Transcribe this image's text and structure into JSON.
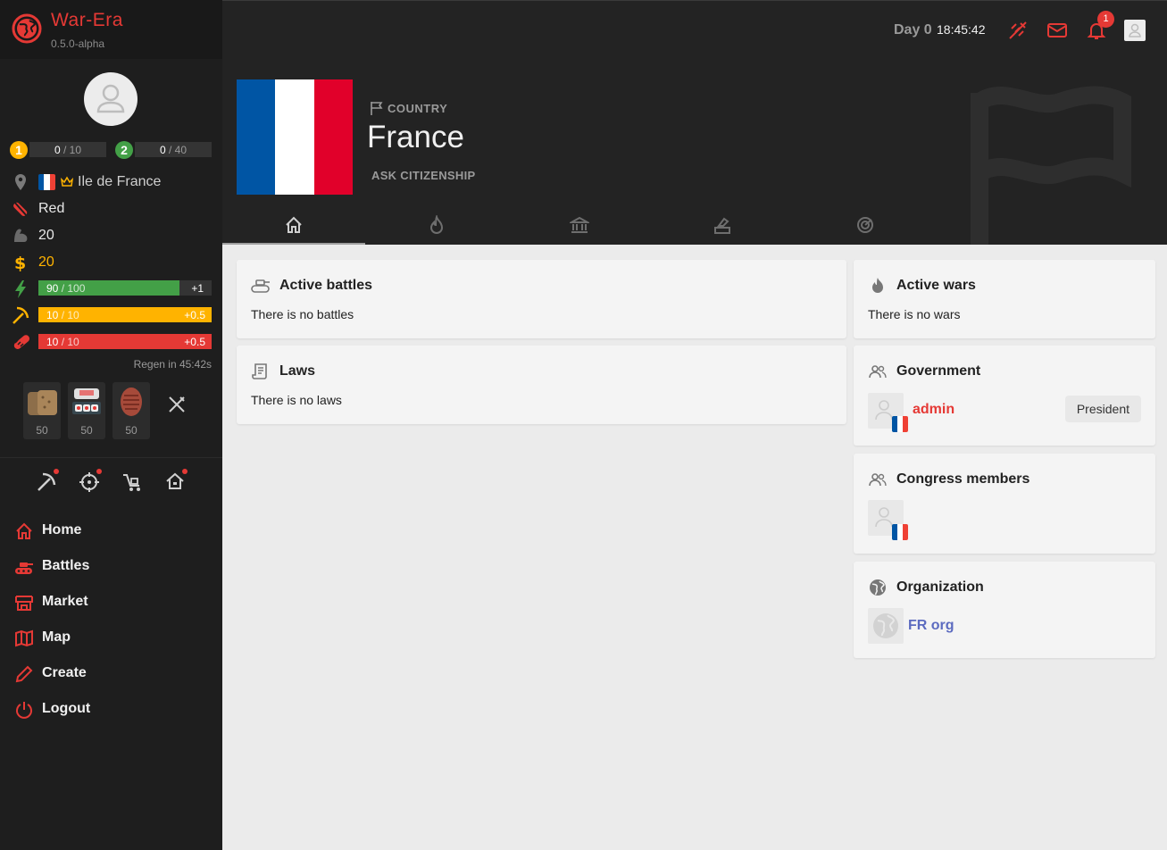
{
  "app": {
    "name": "War-Era",
    "version": "0.5.0-alpha"
  },
  "colors": {
    "brand": "#e53935",
    "energy": "#43a047",
    "work": "#ffb300",
    "health": "#e53935",
    "level1": "#ffb300",
    "level2": "#43a047",
    "link": "#5c6bc0"
  },
  "player": {
    "level1": {
      "badge": "1",
      "current": "0",
      "max": "/ 10",
      "progress": 0
    },
    "level2": {
      "badge": "2",
      "current": "0",
      "max": "/ 40",
      "progress": 0
    },
    "region": "Ile de France",
    "party": "Red",
    "strength": "20",
    "money": "20",
    "energy": {
      "current": "90",
      "max": "/ 100",
      "rate": "+1",
      "progress": 0.9
    },
    "work": {
      "current": "10",
      "max": "/ 10",
      "rate": "+0.5",
      "progress": 1.0
    },
    "health": {
      "current": "10",
      "max": "/ 10",
      "rate": "+0.5",
      "progress": 1.0
    },
    "regen": "Regen in 45:42s",
    "food": [
      {
        "name": "bread",
        "count": "50"
      },
      {
        "name": "sushi",
        "count": "50"
      },
      {
        "name": "steak",
        "count": "50"
      }
    ]
  },
  "quick_actions": [
    "pickaxe-icon",
    "crosshair-icon",
    "cart-icon",
    "house-icon"
  ],
  "nav": [
    {
      "label": "Home",
      "icon": "home-icon"
    },
    {
      "label": "Battles",
      "icon": "tank-icon"
    },
    {
      "label": "Market",
      "icon": "store-icon"
    },
    {
      "label": "Map",
      "icon": "map-icon"
    },
    {
      "label": "Create",
      "icon": "pencil-icon"
    },
    {
      "label": "Logout",
      "icon": "power-icon"
    }
  ],
  "topbar": {
    "day": "Day 0",
    "time": "18:45:42",
    "notifications": "1"
  },
  "country": {
    "label": "COUNTRY",
    "name": "France",
    "action": "ASK CITIZENSHIP"
  },
  "tabs": [
    "home-icon",
    "fire-icon",
    "bank-icon",
    "ballot-icon",
    "radar-icon"
  ],
  "cards": {
    "active_battles": {
      "title": "Active battles",
      "text": "There is no battles"
    },
    "laws": {
      "title": "Laws",
      "text": "There is no laws"
    },
    "active_wars": {
      "title": "Active wars",
      "text": "There is no wars"
    },
    "government": {
      "title": "Government",
      "member": "admin",
      "role": "President"
    },
    "congress": {
      "title": "Congress members"
    },
    "organization": {
      "title": "Organization",
      "name": "FR org"
    }
  }
}
